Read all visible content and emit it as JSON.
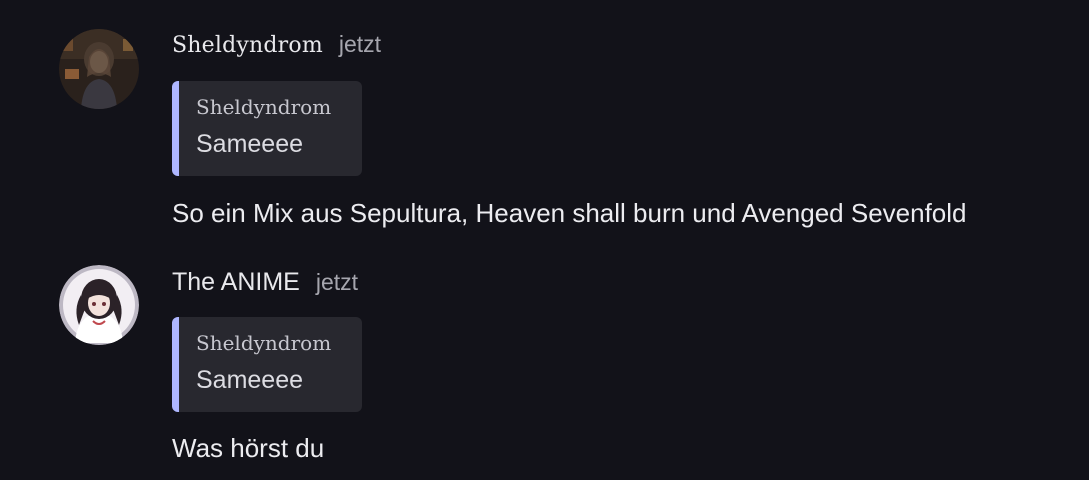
{
  "messages": [
    {
      "username": "Sheldyndrom",
      "timestamp": "jetzt",
      "avatar_icon": "user-avatar-icon",
      "reply": {
        "author": "Sheldyndrom",
        "text": "Sameeee"
      },
      "text": "So ein Mix aus Sepultura, Heaven shall burn und Avenged Sevenfold"
    },
    {
      "username": "The ANIME",
      "timestamp": "jetzt",
      "avatar_icon": "anime-avatar-icon",
      "reply": {
        "author": "Sheldyndrom",
        "text": "Sameeee"
      },
      "text": "Was hörst du"
    }
  ],
  "colors": {
    "background": "#121219",
    "quote_background": "#28282f",
    "quote_accent": "#aeb6ff",
    "timestamp": "#a6a6ae"
  }
}
